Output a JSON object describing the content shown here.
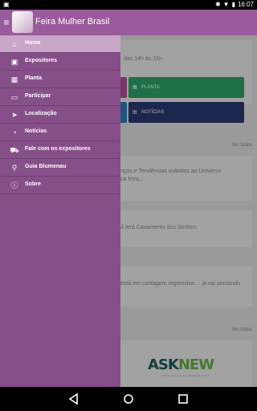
{
  "status_bar": {
    "time": "16:07"
  },
  "app": {
    "title": "Feira Mulher Brasil"
  },
  "content": {
    "event_hours": "das 14h às 21h",
    "buttons": [
      {
        "label": "PLANTA",
        "icon": "map-icon",
        "color": "#2ea86a"
      },
      {
        "label": "NOTÍCIAS",
        "icon": "news-icon",
        "color": "#2c3a74"
      }
    ],
    "see_all": "Ver todos",
    "news": [
      {
        "text": "nços e Tendências voltados ao Universo"
      },
      {
        "text": "ca feira..."
      },
      {
        "text": "á terá Casamento dos Sonhos"
      },
      {
        "text": "está em contagem regressiva ... já vai anotando"
      }
    ],
    "partner": {
      "name_a": "ASK",
      "name_b": "NEW",
      "sub": "PROPAGANDA MARKETING"
    }
  },
  "drawer": {
    "items": [
      {
        "label": "Home",
        "icon": "home-icon"
      },
      {
        "label": "Expositores",
        "icon": "store-icon"
      },
      {
        "label": "Planta",
        "icon": "map-icon"
      },
      {
        "label": "Participar",
        "icon": "id-card-icon"
      },
      {
        "label": "Localização",
        "icon": "location-arrow-icon"
      },
      {
        "label": "Notícias",
        "icon": "rss-icon"
      },
      {
        "label": "Fale com os expositores",
        "icon": "cart-icon"
      },
      {
        "label": "Guia Blumenau",
        "icon": "search-icon"
      },
      {
        "label": "Sobre",
        "icon": "info-icon"
      }
    ]
  },
  "colors": {
    "app_bar": "#9a5a9c",
    "drawer": "#874f89",
    "drawer_active": "#c7a6c8"
  }
}
